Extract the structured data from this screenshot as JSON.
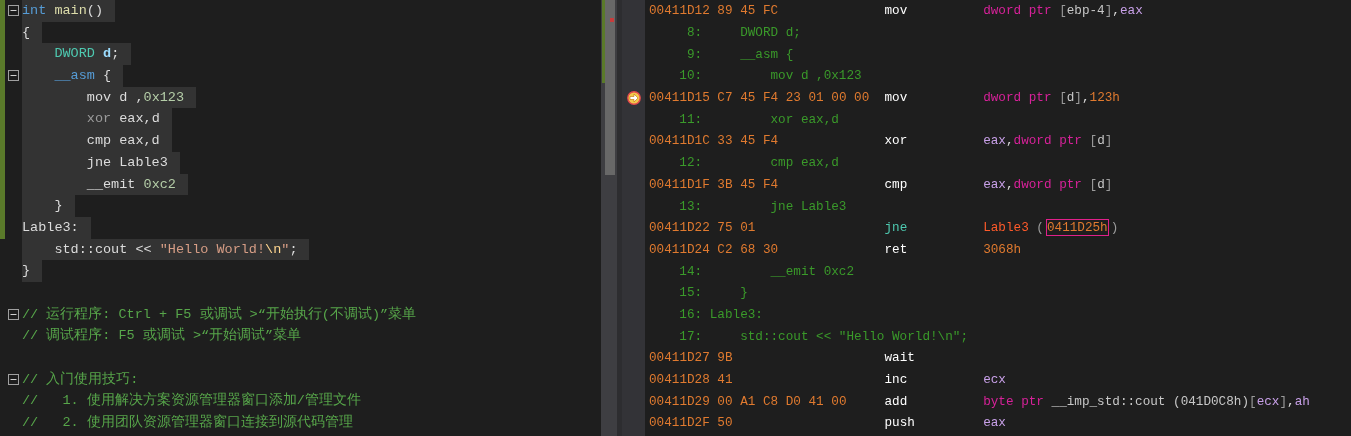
{
  "editor": {
    "lines": [
      {
        "kind": "code",
        "tokens": [
          {
            "text": "int",
            "kind": "kw"
          },
          {
            "text": " main",
            "kind": "fn"
          },
          {
            "text": "()",
            "kind": "p"
          }
        ],
        "fold": {
          "expanded": true
        },
        "highlighted": true,
        "changed": true
      },
      {
        "kind": "code",
        "tokens": [
          {
            "text": "{",
            "kind": "p"
          }
        ],
        "highlighted": true,
        "changed": true
      },
      {
        "kind": "code",
        "tokens": [
          {
            "text": "    DWORD",
            "kind": "type"
          },
          {
            "text": " d",
            "kind": "var"
          },
          {
            "text": ";",
            "kind": "p"
          }
        ],
        "highlighted": true,
        "changed": true
      },
      {
        "kind": "code",
        "tokens": [
          {
            "text": "    __asm",
            "kind": "kw"
          },
          {
            "text": " {",
            "kind": "p"
          }
        ],
        "fold": {
          "expanded": true
        },
        "highlighted": true,
        "changed": true
      },
      {
        "kind": "code",
        "tokens": [
          {
            "text": "        mov d ,",
            "kind": "p"
          },
          {
            "text": "0x123",
            "kind": "num"
          }
        ],
        "highlighted": true,
        "changed": true
      },
      {
        "kind": "code",
        "tokens": [
          {
            "text": "        xor",
            "kind": "dim"
          },
          {
            "text": " eax,d",
            "kind": "p"
          }
        ],
        "highlighted": true,
        "changed": true
      },
      {
        "kind": "code",
        "tokens": [
          {
            "text": "        cmp eax,d",
            "kind": "p"
          }
        ],
        "highlighted": true,
        "changed": true
      },
      {
        "kind": "code",
        "tokens": [
          {
            "text": "        jne Lable3",
            "kind": "p"
          }
        ],
        "highlighted": true,
        "changed": true
      },
      {
        "kind": "code",
        "tokens": [
          {
            "text": "        __emit ",
            "kind": "p"
          },
          {
            "text": "0xc2",
            "kind": "num"
          }
        ],
        "highlighted": true,
        "changed": true
      },
      {
        "kind": "code",
        "tokens": [
          {
            "text": "    }",
            "kind": "p"
          }
        ],
        "highlighted": true,
        "changed": true
      },
      {
        "kind": "code",
        "tokens": [
          {
            "text": "Lable3:",
            "kind": "p"
          }
        ],
        "highlighted": true,
        "changed": true
      },
      {
        "kind": "code",
        "tokens": [
          {
            "text": "    std::cout << ",
            "kind": "p"
          },
          {
            "text": "\"Hello World!",
            "kind": "str"
          },
          {
            "text": "\\n",
            "kind": "esc"
          },
          {
            "text": "\"",
            "kind": "str"
          },
          {
            "text": ";",
            "kind": "p"
          }
        ],
        "highlighted": true,
        "changed": false
      },
      {
        "kind": "code",
        "tokens": [
          {
            "text": "}",
            "kind": "p"
          }
        ],
        "highlighted": true,
        "changed": false
      },
      {
        "kind": "blank"
      },
      {
        "kind": "code",
        "tokens": [
          {
            "text": "// 运行程序: Ctrl + F5 或调试 >“开始执行(不调试)”菜单",
            "kind": "cmt"
          }
        ],
        "fold": {
          "expanded": true
        },
        "highlighted": false,
        "changed": false
      },
      {
        "kind": "code",
        "tokens": [
          {
            "text": "// 调试程序: F5 或调试 >“开始调试”菜单",
            "kind": "cmt"
          }
        ],
        "highlighted": false,
        "changed": false
      },
      {
        "kind": "blank"
      },
      {
        "kind": "code",
        "tokens": [
          {
            "text": "// 入门使用技巧:",
            "kind": "cmt"
          }
        ],
        "fold": {
          "expanded": true
        },
        "highlighted": false,
        "changed": false
      },
      {
        "kind": "code",
        "tokens": [
          {
            "text": "//   1. 使用解决方案资源管理器窗口添加/管理文件",
            "kind": "cmt"
          }
        ],
        "highlighted": false,
        "changed": false
      },
      {
        "kind": "code",
        "tokens": [
          {
            "text": "//   2. 使用团队资源管理器窗口连接到源代码管理",
            "kind": "cmt"
          }
        ],
        "highlighted": false,
        "changed": false
      }
    ]
  },
  "disassembly": {
    "rows": [
      {
        "kind": "asm",
        "address": "00411D12",
        "bytes": "89 45 FC",
        "mnemonic": {
          "text": "mov",
          "kind": "op"
        },
        "operands": [
          {
            "text": "dword ptr ",
            "kind": "kw"
          },
          {
            "text": "[",
            "kind": "br"
          },
          {
            "text": "ebp-4",
            "kind": "id"
          },
          {
            "text": "]",
            "kind": "br"
          },
          {
            "text": ",",
            "kind": "p"
          },
          {
            "text": "eax",
            "kind": "reg"
          }
        ],
        "current": false
      },
      {
        "kind": "source",
        "number": "8:",
        "text": "    DWORD d;"
      },
      {
        "kind": "source",
        "number": "9:",
        "text": "    __asm {"
      },
      {
        "kind": "source",
        "number": "10:",
        "text": "        mov d ,0x123"
      },
      {
        "kind": "asm",
        "address": "00411D15",
        "bytes": "C7 45 F4 23 01 00 00",
        "mnemonic": {
          "text": "mov",
          "kind": "op"
        },
        "operands": [
          {
            "text": "dword ptr ",
            "kind": "kw"
          },
          {
            "text": "[",
            "kind": "br"
          },
          {
            "text": "d",
            "kind": "id"
          },
          {
            "text": "]",
            "kind": "br"
          },
          {
            "text": ",",
            "kind": "p"
          },
          {
            "text": "123h",
            "kind": "num"
          }
        ],
        "current": true
      },
      {
        "kind": "source",
        "number": "11:",
        "text": "        xor eax,d"
      },
      {
        "kind": "asm",
        "address": "00411D1C",
        "bytes": "33 45 F4",
        "mnemonic": {
          "text": "xor",
          "kind": "op"
        },
        "operands": [
          {
            "text": "eax",
            "kind": "reg"
          },
          {
            "text": ",",
            "kind": "p"
          },
          {
            "text": "dword ptr ",
            "kind": "kw"
          },
          {
            "text": "[",
            "kind": "br"
          },
          {
            "text": "d",
            "kind": "id"
          },
          {
            "text": "]",
            "kind": "br"
          }
        ],
        "current": false
      },
      {
        "kind": "source",
        "number": "12:",
        "text": "        cmp eax,d"
      },
      {
        "kind": "asm",
        "address": "00411D1F",
        "bytes": "3B 45 F4",
        "mnemonic": {
          "text": "cmp",
          "kind": "op"
        },
        "operands": [
          {
            "text": "eax",
            "kind": "reg"
          },
          {
            "text": ",",
            "kind": "p"
          },
          {
            "text": "dword ptr ",
            "kind": "kw"
          },
          {
            "text": "[",
            "kind": "br"
          },
          {
            "text": "d",
            "kind": "id"
          },
          {
            "text": "]",
            "kind": "br"
          }
        ],
        "current": false
      },
      {
        "kind": "source",
        "number": "13:",
        "text": "        jne Lable3"
      },
      {
        "kind": "asm",
        "address": "00411D22",
        "bytes": "75 01",
        "mnemonic": {
          "text": "jne",
          "kind": "jump"
        },
        "operands": [
          {
            "text": "Lable3 ",
            "kind": "lbl"
          },
          {
            "text": "(",
            "kind": "br"
          },
          {
            "text": "0411D25h",
            "kind": "boxed"
          },
          {
            "text": ")",
            "kind": "br"
          }
        ],
        "current": false
      },
      {
        "kind": "asm",
        "address": "00411D24",
        "bytes": "C2 68 30",
        "mnemonic": {
          "text": "ret",
          "kind": "op"
        },
        "operands": [
          {
            "text": "3068h",
            "kind": "num"
          }
        ],
        "current": false
      },
      {
        "kind": "source",
        "number": "14:",
        "text": "        __emit 0xc2"
      },
      {
        "kind": "source",
        "number": "15:",
        "text": "    }"
      },
      {
        "kind": "source",
        "number": "16:",
        "text": "Lable3:"
      },
      {
        "kind": "source",
        "number": "17:",
        "text": "    std::cout << \"Hello World!\\n\";"
      },
      {
        "kind": "asm",
        "address": "00411D27",
        "bytes": "9B",
        "mnemonic": {
          "text": "wait",
          "kind": "op"
        },
        "current": false
      },
      {
        "kind": "asm",
        "address": "00411D28",
        "bytes": "41",
        "mnemonic": {
          "text": "inc",
          "kind": "op"
        },
        "operands": [
          {
            "text": "ecx",
            "kind": "reg"
          }
        ],
        "current": false
      },
      {
        "kind": "asm",
        "address": "00411D29",
        "bytes": "00 A1 C8 D0 41 00",
        "mnemonic": {
          "text": "add",
          "kind": "op"
        },
        "operands": [
          {
            "text": "byte ptr ",
            "kind": "kw"
          },
          {
            "text": "__imp_std::cout (041D0C8h)",
            "kind": "id"
          },
          {
            "text": "[",
            "kind": "br"
          },
          {
            "text": "ecx",
            "kind": "reg"
          },
          {
            "text": "]",
            "kind": "br"
          },
          {
            "text": ",",
            "kind": "p"
          },
          {
            "text": "ah",
            "kind": "reg"
          }
        ],
        "current": false
      },
      {
        "kind": "asm",
        "address": "00411D2F",
        "bytes": "50",
        "mnemonic": {
          "text": "push",
          "kind": "op"
        },
        "operands": [
          {
            "text": "eax",
            "kind": "reg"
          }
        ],
        "current": false
      }
    ]
  }
}
